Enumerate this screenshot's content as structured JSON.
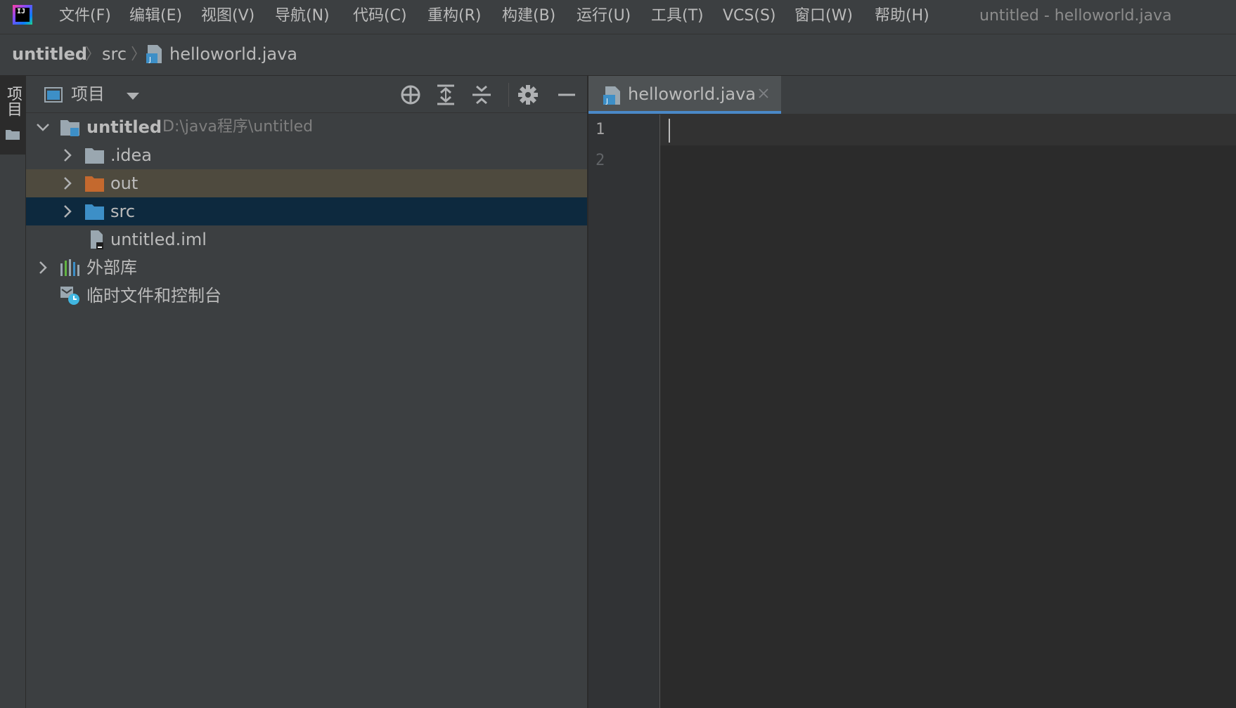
{
  "menubar": {
    "items": [
      "文件(F)",
      "编辑(E)",
      "视图(V)",
      "导航(N)",
      "代码(C)",
      "重构(R)",
      "构建(B)",
      "运行(U)",
      "工具(T)",
      "VCS(S)",
      "窗口(W)",
      "帮助(H)"
    ],
    "window_title": "untitled - helloworld.java",
    "logo_text": "IJ"
  },
  "breadcrumb": {
    "project": "untitled",
    "folder": "src",
    "file": "helloworld.java"
  },
  "tool_strip": {
    "project_label": "项目"
  },
  "project_panel": {
    "title": "项目",
    "tree": [
      {
        "label": "untitled",
        "path": "D:\\java程序\\untitled"
      },
      {
        "label": ".idea"
      },
      {
        "label": "out"
      },
      {
        "label": "src"
      },
      {
        "label": "untitled.iml"
      },
      {
        "label": "外部库"
      },
      {
        "label": "临时文件和控制台"
      }
    ]
  },
  "editor": {
    "tab_label": "helloworld.java",
    "line_numbers": [
      "1",
      "2"
    ]
  },
  "colors": {
    "accent": "#4a88c7",
    "selection": "#0d293e",
    "excluded_folder": "#c4692e",
    "source_folder": "#3d8fc7"
  }
}
